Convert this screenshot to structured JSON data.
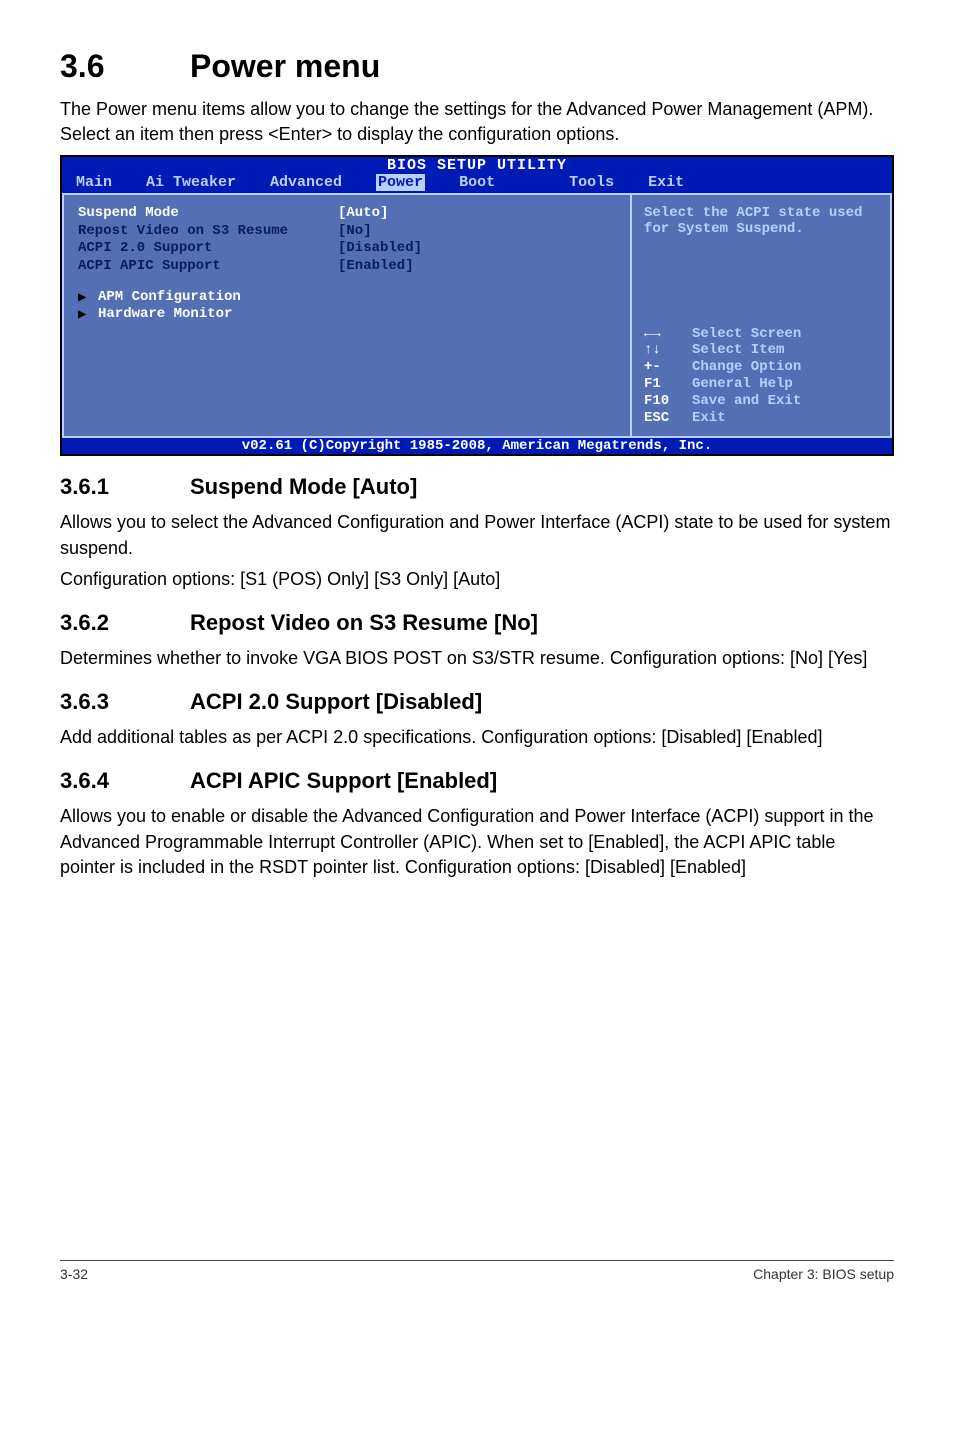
{
  "section": {
    "number": "3.6",
    "title": "Power menu",
    "intro": "The Power menu items allow you to change the settings for the Advanced Power Management (APM). Select an item then press <Enter> to display the configuration options."
  },
  "bios": {
    "header": "BIOS SETUP UTILITY",
    "tabs": {
      "t0": "Main",
      "t1": "Ai Tweaker",
      "t2": "Advanced",
      "t3": "Power",
      "t4": "Boot",
      "t5": "Tools",
      "t6": "Exit"
    },
    "rows": {
      "r0": {
        "label": "Suspend Mode",
        "value": "[Auto]"
      },
      "r1": {
        "label": "Repost Video on S3 Resume",
        "value": "[No]"
      },
      "r2": {
        "label": "ACPI 2.0 Support",
        "value": "[Disabled]"
      },
      "r3": {
        "label": "ACPI APIC Support",
        "value": "[Enabled]"
      }
    },
    "submenus": {
      "s0": "APM Configuration",
      "s1": "Hardware Monitor"
    },
    "sidebar": {
      "help": "Select the ACPI state used for System Suspend.",
      "hints": {
        "h0": {
          "key": "←→",
          "desc": "Select Screen"
        },
        "h1": {
          "key": "↑↓",
          "desc": "Select Item"
        },
        "h2": {
          "key": "+-",
          "desc": " Change Option"
        },
        "h3": {
          "key": "F1",
          "desc": "General Help"
        },
        "h4": {
          "key": "F10",
          "desc": "Save and Exit"
        },
        "h5": {
          "key": "ESC",
          "desc": "Exit"
        }
      }
    },
    "footer": "v02.61 (C)Copyright 1985-2008, American Megatrends, Inc."
  },
  "sub1": {
    "num": "3.6.1",
    "title": "Suspend Mode [Auto]",
    "p1": "Allows you to select the Advanced Configuration and Power Interface (ACPI) state to be used for system suspend.",
    "p2": "Configuration options: [S1 (POS) Only] [S3 Only] [Auto]"
  },
  "sub2": {
    "num": "3.6.2",
    "title": "Repost Video on S3 Resume [No]",
    "p1": "Determines whether to invoke VGA BIOS POST on S3/STR resume. Configuration options: [No] [Yes]"
  },
  "sub3": {
    "num": "3.6.3",
    "title": "ACPI 2.0 Support [Disabled]",
    "p1": "Add additional tables as per ACPI 2.0 specifications. Configuration options: [Disabled] [Enabled]"
  },
  "sub4": {
    "num": "3.6.4",
    "title": "ACPI APIC Support [Enabled]",
    "p1": "Allows you to enable or disable the Advanced Configuration and Power Interface (ACPI) support in the Advanced Programmable Interrupt Controller (APIC). When set to [Enabled], the ACPI APIC table pointer is included in the RSDT pointer list. Configuration options: [Disabled] [Enabled]"
  },
  "footer": {
    "left": "3-32",
    "right": "Chapter 3: BIOS setup"
  }
}
